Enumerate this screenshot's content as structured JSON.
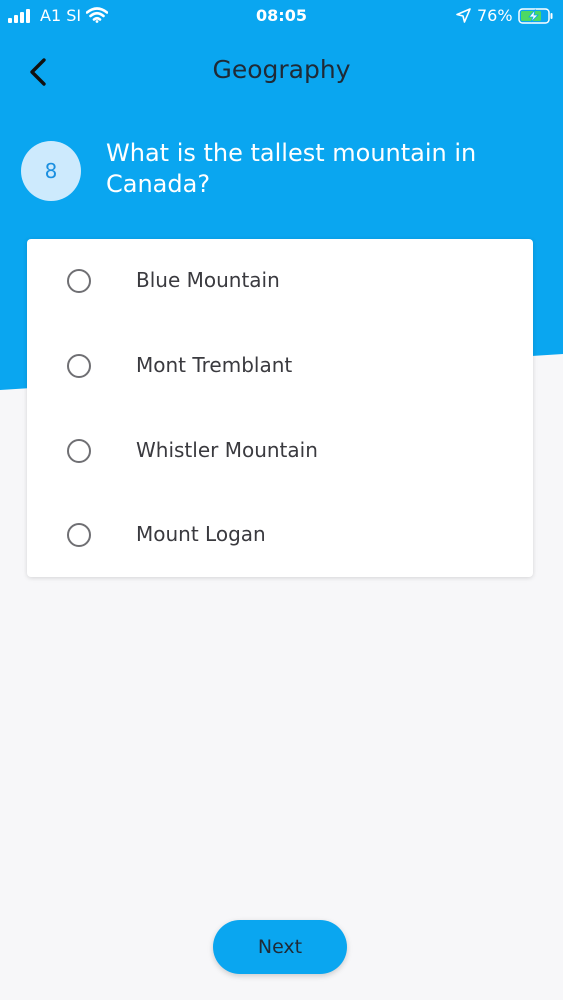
{
  "colors": {
    "primary": "#0aa6f0",
    "background": "#f7f7f9",
    "number_badge": "#cdeafd"
  },
  "status_bar": {
    "carrier": "A1 SI",
    "time": "08:05",
    "battery": "76%",
    "icons": [
      "signal-icon",
      "wifi-icon",
      "location-icon",
      "battery-charging-icon"
    ]
  },
  "header": {
    "back_icon": "chevron-left-icon",
    "title": "Geography"
  },
  "question": {
    "number": "8",
    "text": "What is the tallest mountain in Canada?"
  },
  "options": [
    {
      "label": "Blue Mountain",
      "selected": false
    },
    {
      "label": "Mont Tremblant",
      "selected": false
    },
    {
      "label": "Whistler Mountain",
      "selected": false
    },
    {
      "label": "Mount Logan",
      "selected": false
    }
  ],
  "next_label": "Next"
}
